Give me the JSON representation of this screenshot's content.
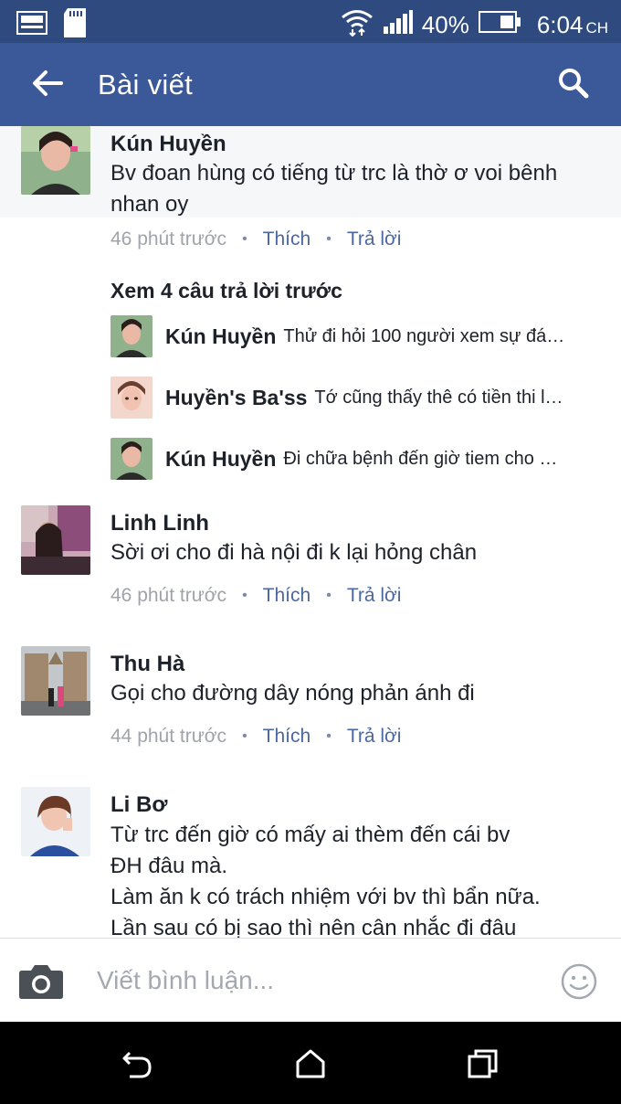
{
  "status_bar": {
    "battery": "40%",
    "time": "6:04",
    "time_suffix": "CH",
    "icons": [
      "gallery-icon",
      "sd-card-icon",
      "wifi-icon",
      "signal-icon",
      "battery-icon"
    ]
  },
  "app_bar": {
    "title": "Bài viết",
    "back_icon": "arrow-left-icon",
    "search_icon": "search-icon"
  },
  "comments": [
    {
      "name": "Kún Huyền",
      "text": "Bv đoan hùng có tiếng từ trc là thờ ơ voi bênh nhan oy",
      "time": "46 phút trước",
      "like": "Thích",
      "reply": "Trả lời"
    },
    {
      "name": "Linh Linh",
      "text": "Sời ơi cho đi hà nội đi k lại hỏng chân",
      "time": "46 phút trước",
      "like": "Thích",
      "reply": "Trả lời"
    },
    {
      "name": "Thu Hà",
      "text": "Gọi cho đường dây nóng phản ánh đi",
      "time": "44 phút trước",
      "like": "Thích",
      "reply": "Trả lời"
    },
    {
      "name": "Li Bơ",
      "text": "Từ trc đến giờ có mấy ai thèm đến cái bv\nĐH đâu mà.\nLàm ăn k có trách nhiệm với bv thì bẩn nữa.\nLần sau có bị sao thì nên cân nhắc đi đâu"
    }
  ],
  "more_replies": "Xem 4 câu trả lời trước",
  "replies": [
    {
      "name": "Kún Huyền",
      "text": "Thử đi hỏi 100 người xem sự đá…"
    },
    {
      "name": "Huyền's Ba'ss",
      "text": "Tớ cũng thấy thê có tiền thi l…"
    },
    {
      "name": "Kún Huyền",
      "text": "Đi chữa bệnh đến giờ tiem cho …"
    }
  ],
  "composer": {
    "placeholder": "Viết bình luận...",
    "camera_icon": "camera-icon",
    "emoji_icon": "emoji-icon"
  },
  "navbar": {
    "icons": [
      "back-nav-icon",
      "home-nav-icon",
      "recents-nav-icon"
    ]
  },
  "colors": {
    "status_bar": "#2f4a7f",
    "app_bar": "#3b5998",
    "link": "#4b67a1",
    "meta": "#90949c"
  }
}
